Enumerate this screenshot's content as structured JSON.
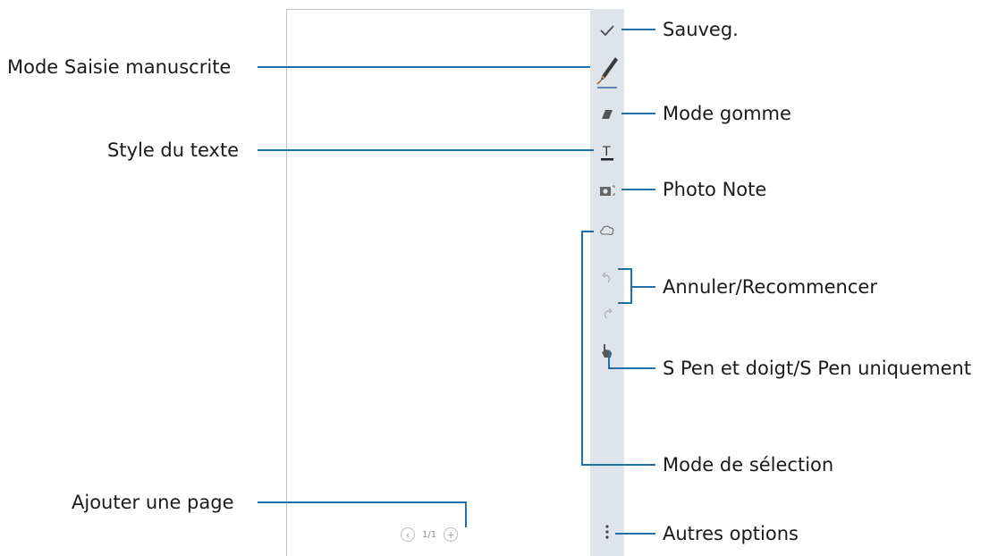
{
  "pager": {
    "page_indicator": "1/1",
    "prev_symbol": "‹",
    "add_symbol": "+"
  },
  "toolbar": {
    "tools": [
      {
        "id": "save",
        "icon": "checkmark-icon"
      },
      {
        "id": "pen",
        "icon": "pen-icon"
      },
      {
        "id": "eraser",
        "icon": "eraser-icon"
      },
      {
        "id": "text",
        "icon": "text-style-icon"
      },
      {
        "id": "photo",
        "icon": "camera-icon"
      },
      {
        "id": "selection",
        "icon": "lasso-icon"
      },
      {
        "id": "undo",
        "icon": "undo-icon"
      },
      {
        "id": "redo",
        "icon": "redo-icon"
      },
      {
        "id": "pen-mode",
        "icon": "hand-pointer-icon"
      },
      {
        "id": "more",
        "icon": "more-vertical-icon"
      }
    ]
  },
  "callouts": {
    "save": "Sauveg.",
    "handwriting_mode": "Mode Saisie manuscrite",
    "eraser_mode": "Mode gomme",
    "text_style": "Style du texte",
    "photo_note": "Photo Note",
    "undo_redo": "Annuler/Recommencer",
    "pen_finger": "S Pen et doigt/S Pen uniquement",
    "selection_mode": "Mode de sélection",
    "add_page": "Ajouter une page",
    "more_options": "Autres options"
  },
  "colors": {
    "toolbar_bg": "#dfe3ea",
    "callout_line": "#1f6fa8",
    "icon": "#4a4a4a",
    "active_underline": "#5e86b8"
  }
}
